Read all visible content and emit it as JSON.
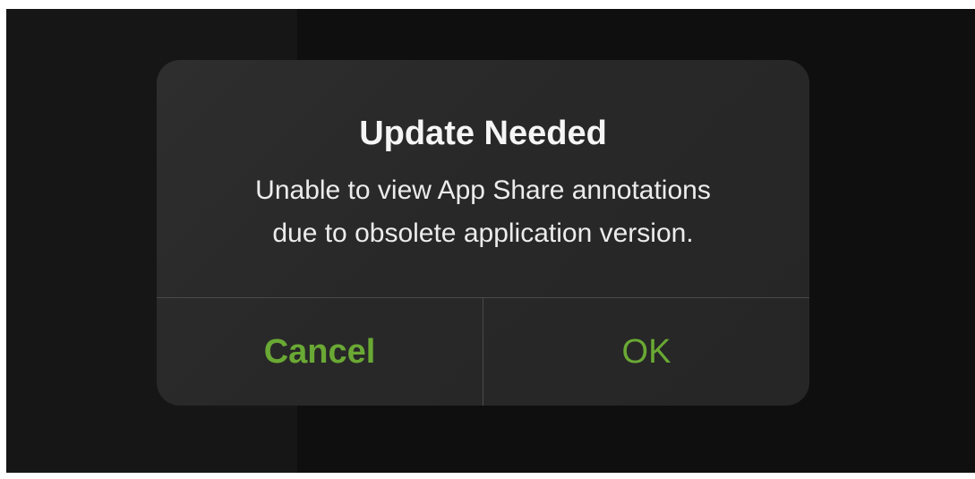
{
  "alert": {
    "title": "Update Needed",
    "message_lines": [
      "Unable to view App Share annotations",
      "due to obsolete application version."
    ],
    "buttons": {
      "cancel_label": "Cancel",
      "ok_label": "OK"
    }
  },
  "colors": {
    "accent": "#6aa934",
    "alert_background": "#2a2a2a",
    "screen_background": "#111111",
    "title_text": "#f5f5f5",
    "message_text": "#ececec",
    "divider": "#4a4a4a"
  }
}
